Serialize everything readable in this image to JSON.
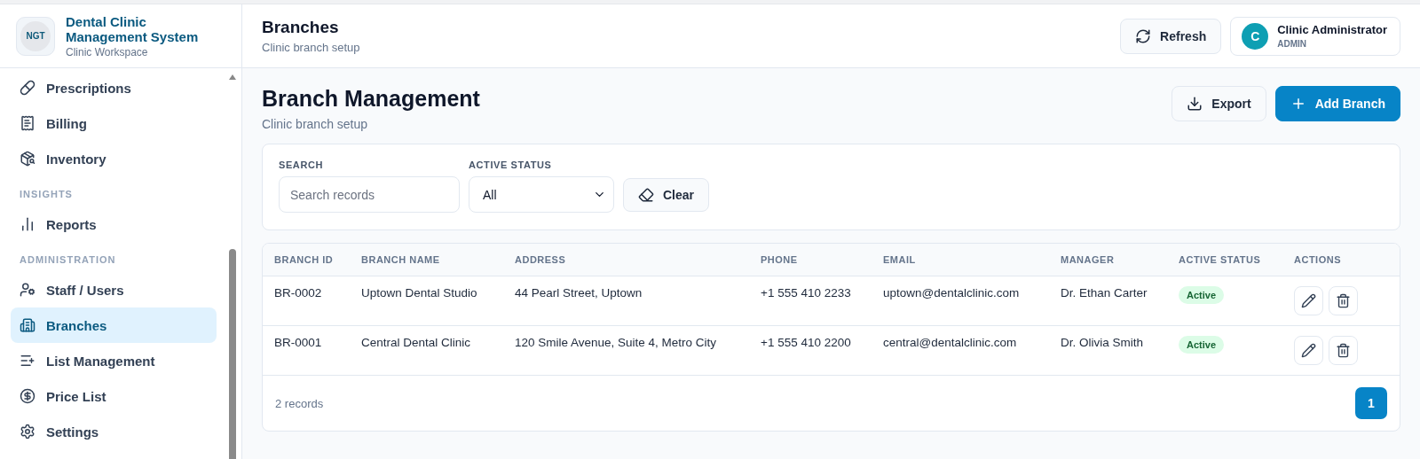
{
  "brand": {
    "logo_text": "NGT",
    "title": "Dental Clinic Management System",
    "subtitle": "Clinic Workspace"
  },
  "sidebar": {
    "items": [
      {
        "kind": "item",
        "label": "Prescriptions",
        "selected": false
      },
      {
        "kind": "item",
        "label": "Billing",
        "selected": false
      },
      {
        "kind": "item",
        "label": "Inventory",
        "selected": false
      },
      {
        "kind": "section",
        "label": "INSIGHTS"
      },
      {
        "kind": "item",
        "label": "Reports",
        "selected": false
      },
      {
        "kind": "section",
        "label": "ADMINISTRATION"
      },
      {
        "kind": "item",
        "label": "Staff / Users",
        "selected": false
      },
      {
        "kind": "item",
        "label": "Branches",
        "selected": true
      },
      {
        "kind": "item",
        "label": "List Management",
        "selected": false
      },
      {
        "kind": "item",
        "label": "Price List",
        "selected": false
      },
      {
        "kind": "item",
        "label": "Settings",
        "selected": false
      }
    ]
  },
  "header": {
    "title": "Branches",
    "subtitle": "Clinic branch setup",
    "refresh": "Refresh",
    "user": {
      "initial": "C",
      "name": "Clinic Administrator",
      "role": "ADMIN"
    }
  },
  "page": {
    "title": "Branch Management",
    "subtitle": "Clinic branch setup",
    "export": "Export",
    "add": "Add Branch"
  },
  "filters": {
    "search": {
      "label": "SEARCH",
      "placeholder": "Search records"
    },
    "status": {
      "label": "ACTIVE STATUS",
      "value": "All"
    },
    "clear": "Clear"
  },
  "table": {
    "columns": [
      "BRANCH ID",
      "BRANCH NAME",
      "ADDRESS",
      "PHONE",
      "EMAIL",
      "MANAGER",
      "ACTIVE STATUS",
      "ACTIONS"
    ],
    "rows": [
      {
        "id": "BR-0002",
        "name": "Uptown Dental Studio",
        "address": "44 Pearl Street, Uptown",
        "phone": "+1 555 410 2233",
        "email": "uptown@dentalclinic.com",
        "manager": "Dr. Ethan Carter",
        "status": {
          "label": "Active",
          "kind": "active"
        }
      },
      {
        "id": "BR-0001",
        "name": "Central Dental Clinic",
        "address": "120 Smile Avenue, Suite 4, Metro City",
        "phone": "+1 555 410 2200",
        "email": "central@dentalclinic.com",
        "manager": "Dr. Olivia Smith",
        "status": {
          "label": "Active",
          "kind": "active"
        }
      }
    ],
    "footer": {
      "count": "2 records",
      "pages": [
        {
          "label": "1",
          "selected": true
        }
      ]
    }
  }
}
